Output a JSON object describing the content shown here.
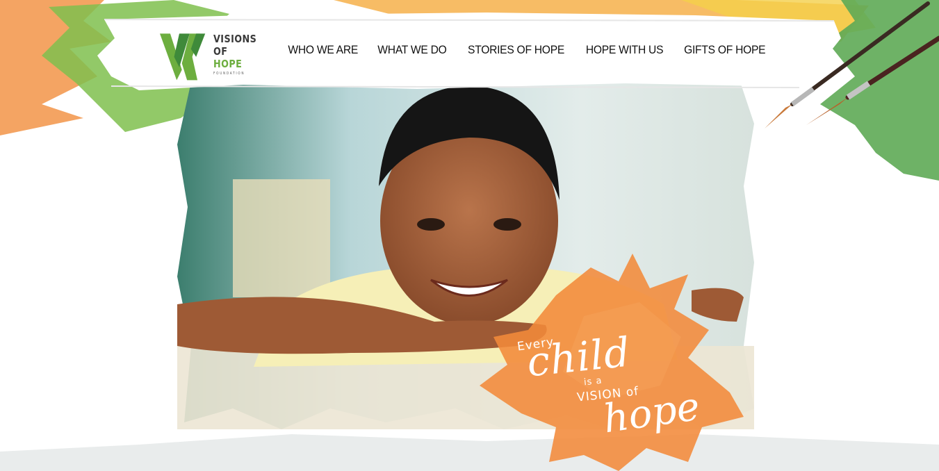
{
  "brand": {
    "line1": "VISIONS",
    "line2": "OF",
    "line3": "HOPE",
    "line4": "FOUNDATION"
  },
  "nav": {
    "items": [
      {
        "label": "WHO WE ARE"
      },
      {
        "label": "WHAT WE DO"
      },
      {
        "label": "STORIES OF HOPE"
      },
      {
        "label": "HOPE WITH US"
      },
      {
        "label": "GIFTS OF HOPE"
      }
    ]
  },
  "hero": {
    "tagline": {
      "every": "Every",
      "child": "child",
      "is_a": "is a",
      "vision_of": "VISION of",
      "hope": "hope"
    }
  },
  "colors": {
    "green": "#6dae3f",
    "dark_green": "#3f8a3a",
    "orange": "#f08a3c",
    "yellow": "#f3c23a"
  },
  "icons": {
    "logo": "vh-logo-mark",
    "paint_brushes": "paint-brushes-icon"
  }
}
